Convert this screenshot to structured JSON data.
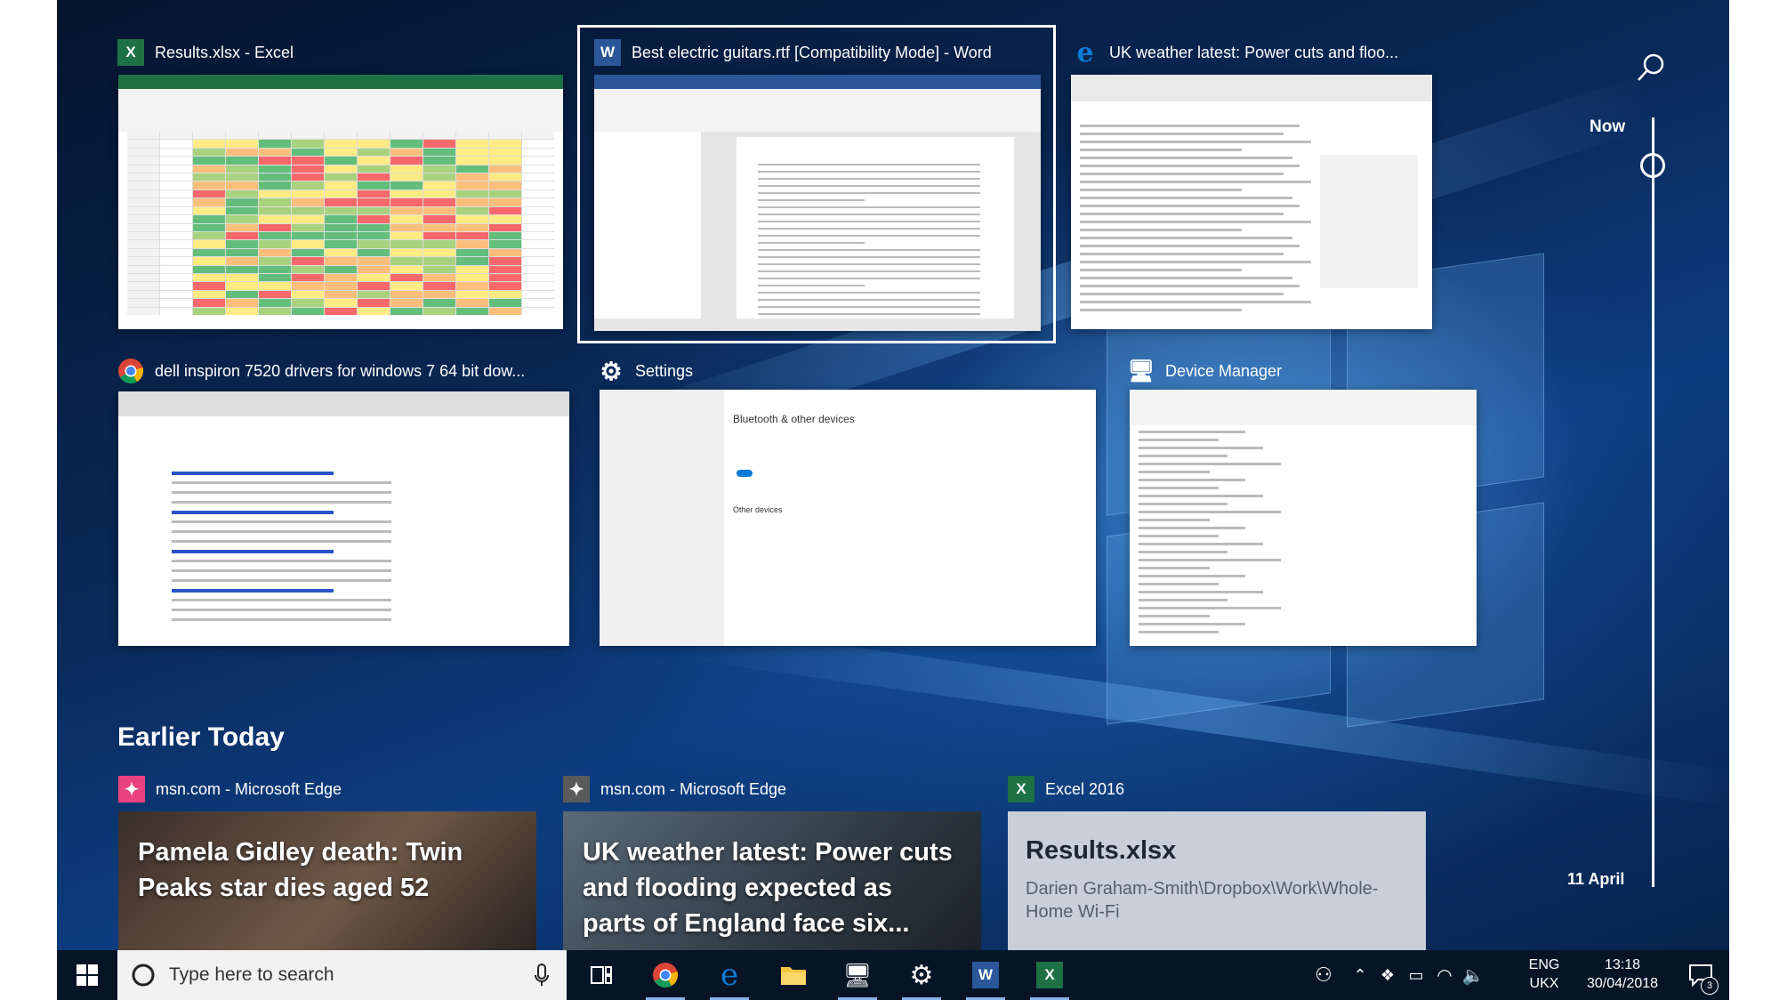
{
  "timeline_windows": [
    {
      "title": "Results.xlsx - Excel",
      "app": "excel"
    },
    {
      "title": "Best electric guitars.rtf [Compatibility Mode] - Word",
      "app": "word",
      "selected": true
    },
    {
      "title": "UK weather latest: Power cuts and floo...",
      "app": "edge"
    },
    {
      "title": "dell inspiron 7520 drivers for windows 7 64 bit dow...",
      "app": "chrome"
    },
    {
      "title": "Settings",
      "app": "settings"
    },
    {
      "title": "Device Manager",
      "app": "device-manager"
    }
  ],
  "settings_thumb": {
    "heading": "Bluetooth & other devices",
    "other_devices": "Other devices"
  },
  "timeline": {
    "now_label": "Now",
    "date_label": "11 April"
  },
  "earlier": {
    "heading": "Earlier Today",
    "cards": [
      {
        "app_label": "msn.com - Microsoft Edge",
        "headline": "Pamela Gidley death: Twin Peaks star dies aged 52"
      },
      {
        "app_label": "msn.com - Microsoft Edge",
        "headline": "UK weather latest: Power cuts and flooding expected as parts of England face six..."
      },
      {
        "app_label": "Excel 2016",
        "headline": "Results.xlsx",
        "path": "Darien Graham-Smith\\Dropbox\\Work\\Whole-Home Wi-Fi"
      }
    ]
  },
  "taskbar": {
    "search_placeholder": "Type here to search",
    "language_top": "ENG",
    "language_bottom": "UKX",
    "time": "13:18",
    "date": "30/04/2018",
    "notification_count": "3"
  },
  "colors": {
    "excel_green": "#1e7145",
    "word_blue": "#2b579a",
    "edge_blue": "#0c7bd6",
    "taskbar": "#071426",
    "desktop_blue": "#0d3d80"
  }
}
